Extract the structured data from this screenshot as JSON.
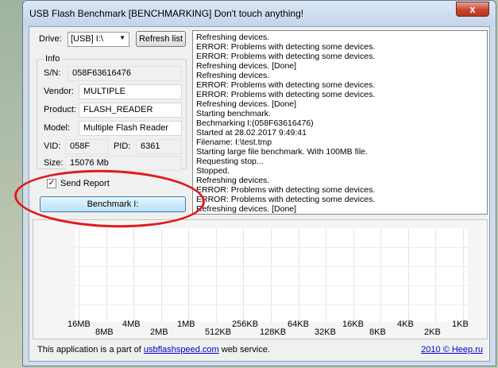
{
  "window": {
    "title": "USB Flash Benchmark [BENCHMARKING] Don't touch anything!",
    "close_symbol": "x"
  },
  "drive": {
    "label": "Drive:",
    "selected": "[USB] I:\\",
    "refresh_label": "Refresh list"
  },
  "info": {
    "title": "Info",
    "sn_label": "S/N:",
    "sn_value": "058F63616476",
    "vendor_label": "Vendor:",
    "vendor_value": "MULTIPLE",
    "product_label": "Product:",
    "product_value": "FLASH_READER",
    "model_label": "Model:",
    "model_value": "Multiple Flash Reader",
    "vid_label": "VID:",
    "vid_value": "058F",
    "pid_label": "PID:",
    "pid_value": "6361",
    "size_label": "Size:",
    "size_value": "15076 Mb"
  },
  "send_report": {
    "label": "Send Report",
    "checked": true,
    "check_glyph": "✓"
  },
  "benchmark_button": {
    "label": "Benchmark I:"
  },
  "log_lines": [
    "Refreshing devices.",
    "ERROR: Problems with detecting some devices.",
    "ERROR: Problems with detecting some devices.",
    "Refreshing devices. [Done]",
    "Refreshing devices.",
    "ERROR: Problems with detecting some devices.",
    "ERROR: Problems with detecting some devices.",
    "Refreshing devices. [Done]",
    "Starting benchmark.",
    "Bechmarking I:(058F63616476)",
    "Started at 28.02.2017 9:49:41",
    "Filename: I:\\test.tmp",
    "Starting large file benchmark. With 100MB file.",
    "Requesting stop...",
    "Stopped.",
    "Refreshing devices.",
    "ERROR: Problems with detecting some devices.",
    "ERROR: Problems with detecting some devices.",
    "Refreshing devices. [Done]"
  ],
  "chart": {
    "ticks_upper": [
      "16MB",
      "4MB",
      "1MB",
      "256KB",
      "64KB",
      "16KB",
      "4KB",
      "1KB"
    ],
    "ticks_lower": [
      "8MB",
      "2MB",
      "512KB",
      "128KB",
      "32KB",
      "8KB",
      "2KB"
    ]
  },
  "footer": {
    "prefix": "This application is a part of ",
    "link": "usbflashspeed.com",
    "suffix": " web service.",
    "right": "2010 © Heep.ru"
  },
  "colors": {
    "annotation_ellipse": "#e11a1a",
    "benchmark_button": "#b9e1f7",
    "link": "#0000cc"
  }
}
